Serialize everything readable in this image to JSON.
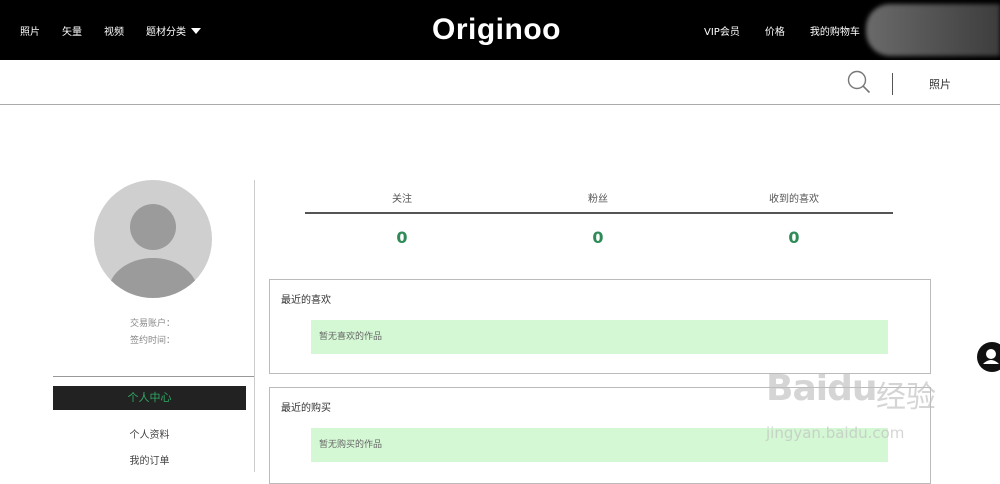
{
  "header": {
    "nav_left": [
      "照片",
      "矢量",
      "视频",
      "题材分类"
    ],
    "logo_text": "Originoo",
    "nav_right": [
      "VIP会员",
      "价格",
      "我的购物车"
    ]
  },
  "subbar": {
    "search_icon": "search-icon",
    "category_label": "照片"
  },
  "profile": {
    "account_label": "交易账户：",
    "sign_label": "签约时间："
  },
  "sidebar": {
    "active_item": "个人中心",
    "items": [
      "个人资料",
      "我的订单"
    ]
  },
  "stats": [
    {
      "label": "关注",
      "value": "0"
    },
    {
      "label": "粉丝",
      "value": "0"
    },
    {
      "label": "收到的喜欢",
      "value": "0"
    }
  ],
  "recent_likes": {
    "title": "最近的喜欢",
    "empty_text": "暂无喜欢的作品"
  },
  "recent_purchases": {
    "title": "最近的购买",
    "empty_text": "暂无购买的作品"
  },
  "watermark": {
    "brand": "Baidu",
    "jingyan": "经验",
    "url": "jingyan.baidu.com"
  },
  "colors": {
    "accent_green": "#2e8b57",
    "empty_bg": "#d4f7d4",
    "topbar_bg": "#000000"
  }
}
